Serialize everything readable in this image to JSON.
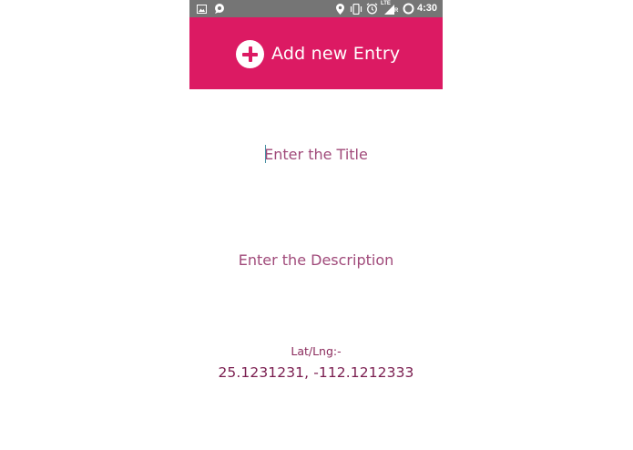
{
  "status_bar": {
    "time": "4:30",
    "left_icons": [
      "image-icon",
      "chat-bubble-icon"
    ],
    "right_icons": [
      "location-icon",
      "vibrate-icon",
      "alarm-icon",
      "lte-signal-icon",
      "battery-saver-icon"
    ],
    "network_label": "LTE",
    "roaming_label": "R",
    "background_color": "#757575"
  },
  "header": {
    "add_button_label": "Add new Entry",
    "accent_color": "#dc1a63"
  },
  "form": {
    "title_placeholder": "Enter the Title",
    "description_placeholder": "Enter the Description",
    "latlng_label": "Lat/Lng:-",
    "latlng_value": "25.1231231, -112.1212333"
  }
}
